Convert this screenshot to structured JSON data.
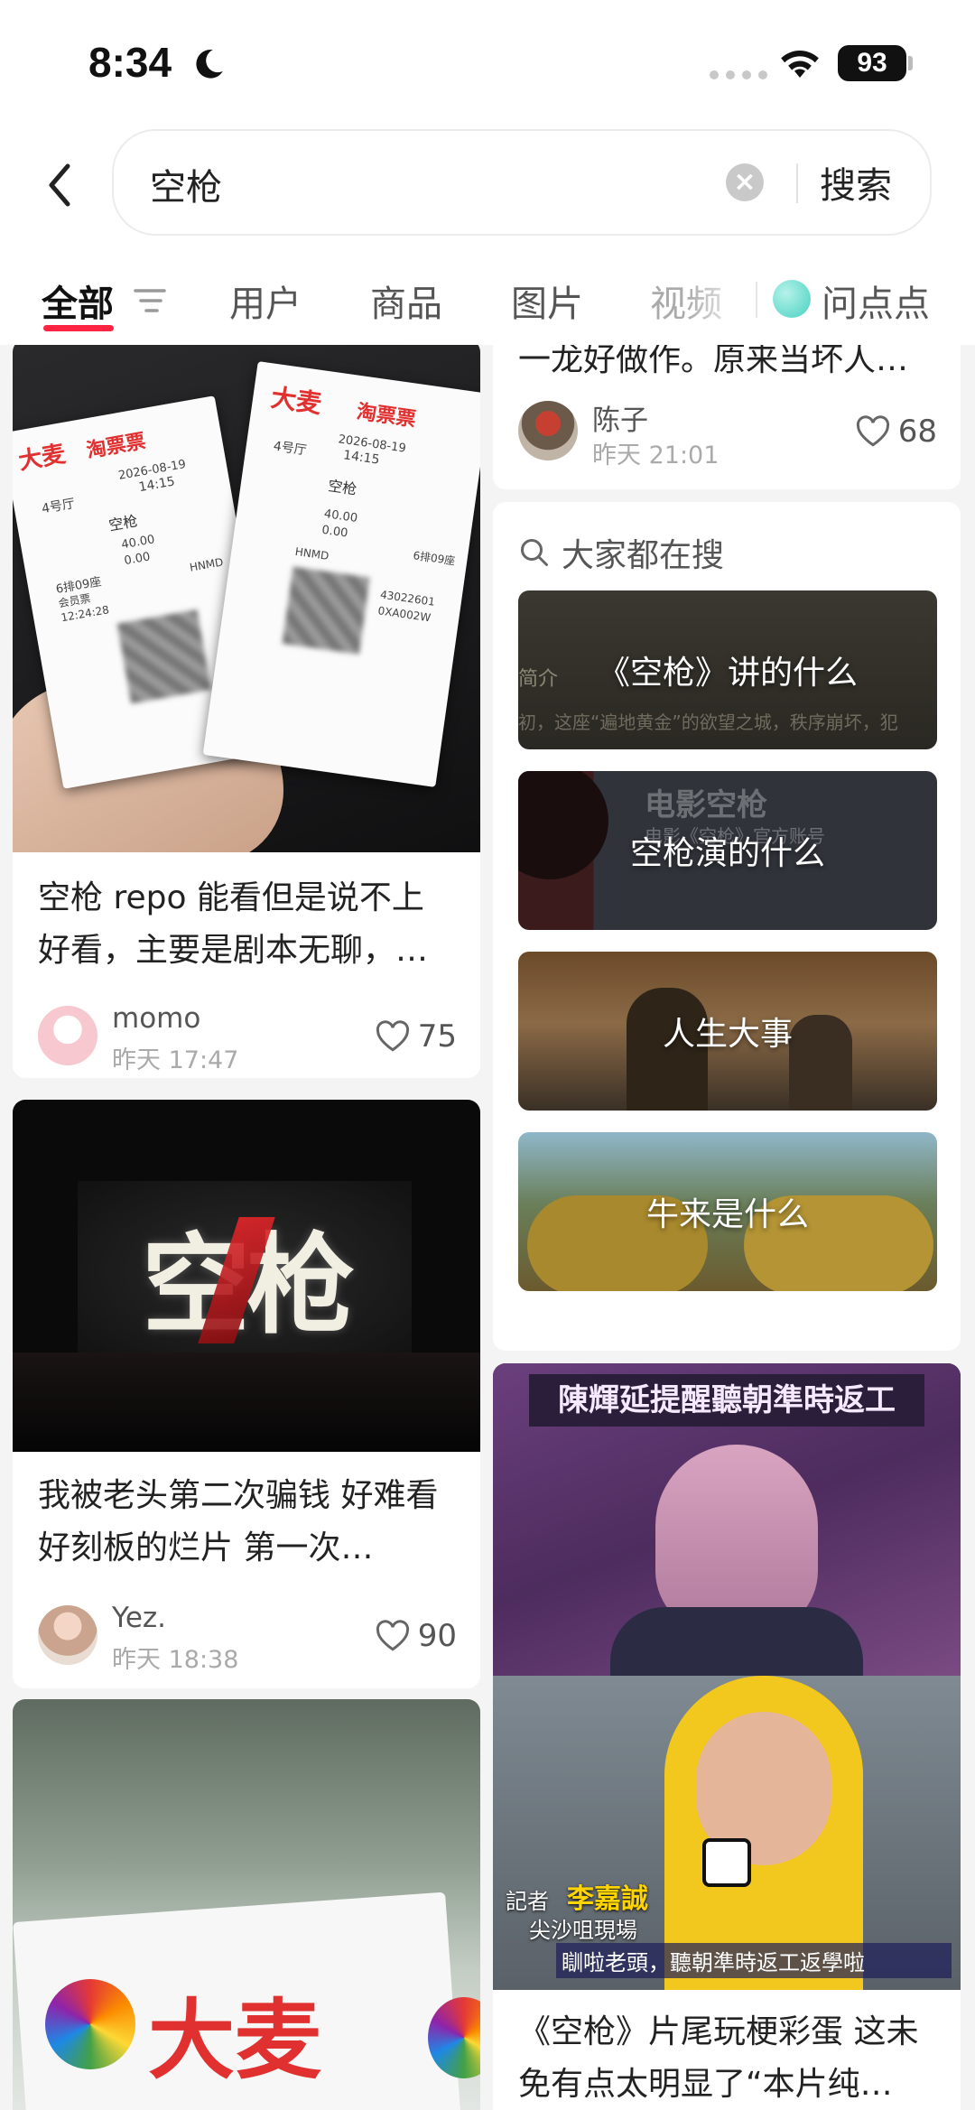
{
  "status_bar": {
    "time": "8:34",
    "battery": "93"
  },
  "search": {
    "query": "空枪",
    "button_label": "搜索"
  },
  "tabs": [
    {
      "label": "全部"
    },
    {
      "label": "用户"
    },
    {
      "label": "商品"
    },
    {
      "label": "图片"
    },
    {
      "label": "视频"
    },
    {
      "label": "问点点"
    }
  ],
  "posts": [
    {
      "title": "空枪 repo 能看但是说不上好看，主要是剧本无聊，…",
      "author": "momo",
      "time": "昨天 17:47",
      "likes": "75",
      "image_text": {
        "brand_left": "大麦",
        "brand_right": "淘票票",
        "hall": "4号厅",
        "date": "2026-08-19",
        "showtime": "14:15",
        "movie": "空枪",
        "price1": "40.00",
        "price2": "0.00",
        "seat": "6排09座",
        "ticket_type": "会员票",
        "print_time": "12:24:28",
        "code": "HNMD",
        "code2": "43022601",
        "code3": "0XA002W"
      }
    },
    {
      "title": "我被老头第二次骗钱 好难看好刻板的烂片 第一次…",
      "author": "Yez.",
      "time": "昨天 18:38",
      "likes": "90",
      "image_text": {
        "screen_title": "空枪"
      }
    },
    {
      "title": "",
      "image_text": {
        "brand": "大麦"
      }
    },
    {
      "title": "一龙好做作。原来当坏人…",
      "author": "陈子",
      "time": "昨天 21:01",
      "likes": "68"
    },
    {
      "title": "《空枪》片尾玩梗彩蛋 这未免有点太明显了“本片纯…",
      "image_text": {
        "top_banner": "陳輝延提醒聽朝準時返工",
        "reporter_label": "記者",
        "reporter_name": "李嘉誠",
        "location": "尖沙咀現場",
        "caption": "瞓啦老頭，聽朝準時返工返學啦"
      }
    }
  ],
  "recommendations": {
    "header": "大家都在搜",
    "items": [
      {
        "label": "《空枪》讲的什么",
        "overlay_text": "简介",
        "overlay_sub": "初，这座“遍地黄金”的欲望之城，秩序崩坏，犯"
      },
      {
        "label": "空枪演的什么",
        "overlay_text": "电影空枪",
        "overlay_sub": "电影《空枪》官方账号"
      },
      {
        "label": "人生大事"
      },
      {
        "label": "牛来是什么"
      }
    ]
  },
  "colors": {
    "accent": "#ff2442",
    "teal": "#46d1c2"
  }
}
